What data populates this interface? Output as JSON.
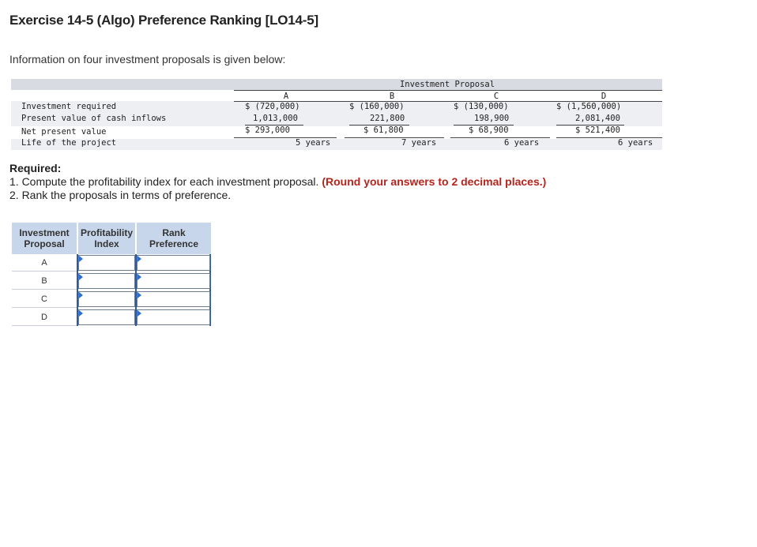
{
  "header": {
    "title": "Exercise 14-5 (Algo) Preference Ranking [LO14-5]",
    "intro": "Information on four investment proposals is given below:"
  },
  "table": {
    "group_header": "Investment Proposal",
    "columns": [
      "A",
      "B",
      "C",
      "D"
    ],
    "rows": [
      {
        "label": "Investment required",
        "values": [
          "$ (720,000)",
          "$ (160,000)",
          "$ (130,000)",
          "$ (1,560,000)"
        ]
      },
      {
        "label": "Present value of cash inflows",
        "values": [
          "1,013,000",
          "221,800",
          "198,900",
          "2,081,400"
        ]
      },
      {
        "label": "Net present value",
        "values": [
          "$ 293,000",
          "$ 61,800",
          "$ 68,900",
          "$ 521,400"
        ]
      },
      {
        "label": "Life of the project",
        "values": [
          "5 years",
          "7 years",
          "6 years",
          "6 years"
        ]
      }
    ]
  },
  "required": {
    "heading": "Required:",
    "item1_text": "1. Compute the profitability index for each investment proposal. ",
    "item1_note": "(Round your answers to 2 decimal places.)",
    "item2_text": "2. Rank the proposals in terms of preference."
  },
  "answer_grid": {
    "headers": [
      "Investment Proposal",
      "Profitability Index",
      "Rank Preference"
    ],
    "proposals": [
      "A",
      "B",
      "C",
      "D"
    ],
    "profitability_index_values": [
      "",
      "",
      "",
      ""
    ],
    "rank_values": [
      "",
      "",
      "",
      ""
    ]
  },
  "colors": {
    "header_band": "#d9dbe3",
    "row_band": "#eeeff3",
    "answer_header": "#c7d6ea",
    "note_red": "#b8231b",
    "input_flag": "#2a6fd6"
  }
}
